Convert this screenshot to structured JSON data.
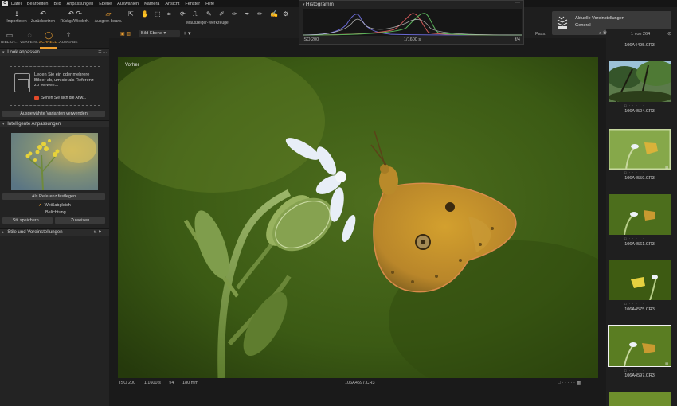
{
  "menubar": {
    "logo": "C",
    "items": [
      "Datei",
      "Bearbeiten",
      "Bild",
      "Anpassungen",
      "Ebene",
      "Auswählen",
      "Kamera",
      "Ansicht",
      "Fenster",
      "Hilfe"
    ]
  },
  "toolbar": {
    "import_label": "Importieren",
    "reset_label": "Zurücksetzen",
    "undo_label": "Rückg./Wiederh.",
    "variants_label": "Ausgew. bearb.",
    "layer_select": "Bild-Ebene",
    "mouse_tools_label": "Mauszeiger-Werkzeuge",
    "pass_label": "Pass."
  },
  "left_tabs": [
    {
      "label": "BIBLIOT..."
    },
    {
      "label": "VERFEIN..."
    },
    {
      "label": "SCHNELL..."
    },
    {
      "label": "AUSGABE"
    }
  ],
  "look_section": {
    "title": "Look anpassen",
    "text": "Legen Sie ein oder mehrere Bilder ab, um sie als Referenz zu verwen...",
    "link": "Sehen Sie sich die Anw...",
    "apply_button": "Ausgewählte Varianten verwenden"
  },
  "smart_section": {
    "title": "Intelligente Anpassungen",
    "set_reference_button": "Als Referenz festlegen",
    "white_balance_label": "Weißabgleich",
    "white_balance_checked": true,
    "exposure_label": "Belichtung",
    "save_style_button": "Stil speichern...",
    "assign_button": "Zuweisen"
  },
  "styles_section": {
    "title": "Stile und Voreinstellungen"
  },
  "histogram": {
    "title": "Histogramm",
    "iso": "ISO 200",
    "shutter": "1/1600 s",
    "aperture": "f/4"
  },
  "notice": {
    "line1": "Aktuelle Voreinstellungen",
    "line2": "General"
  },
  "viewer": {
    "before_label": "Vorher",
    "iso": "ISO 200",
    "shutter": "1/1600 s",
    "aperture": "f/4",
    "focal": "180 mm",
    "filename": "106A4597.CR3"
  },
  "filmstrip": {
    "count": "1 von 264",
    "items": [
      {
        "name": "106A4495.CR3"
      },
      {
        "name": "106A4504.CR3"
      },
      {
        "name": "106A4559.CR3"
      },
      {
        "name": "106A4561.CR3"
      },
      {
        "name": "106A4575.CR3"
      },
      {
        "name": "106A4597.CR3",
        "selected": true
      }
    ]
  },
  "colors": {
    "accent": "#f0a030",
    "panel": "#232323",
    "background": "#1c1c1c"
  }
}
